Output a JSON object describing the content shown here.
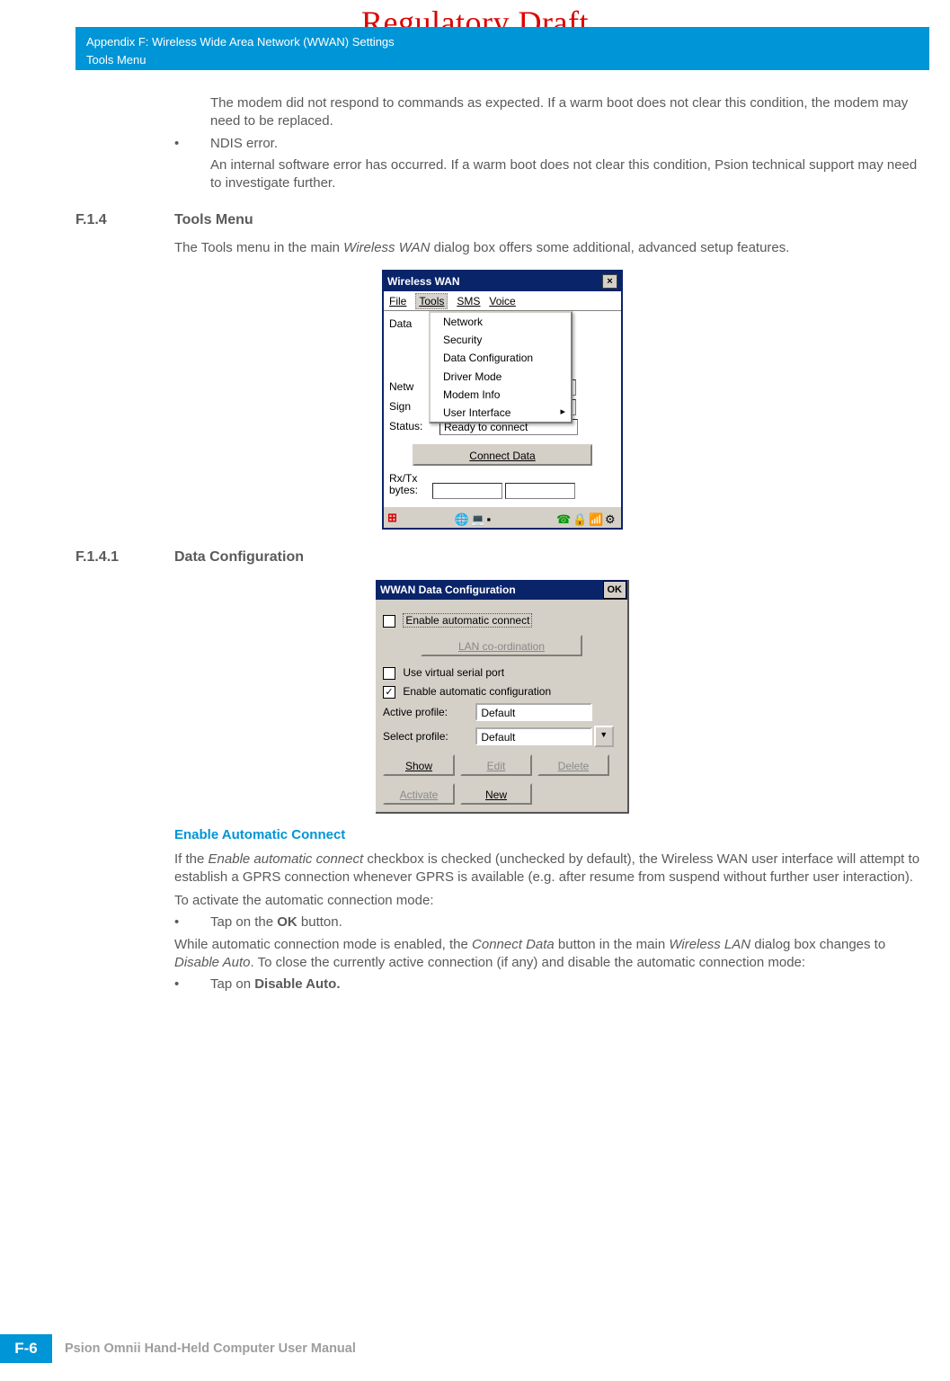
{
  "watermark": "Regulatory Draft",
  "header": {
    "line1": "Appendix F: Wireless Wide Area Network (WWAN) Settings",
    "line2": "Tools Menu"
  },
  "intro": {
    "p1": "The modem did not respond to commands as expected. If a warm boot does not clear this condition, the modem may need to be replaced.",
    "bullet": "NDIS error.",
    "p2": "An internal software error has occurred. If a warm boot does not clear this condition, Psion technical support may need to investigate further."
  },
  "sec_f14": {
    "num": "F.1.4",
    "title": "Tools Menu",
    "desc_pre": "The Tools menu in the main ",
    "desc_em": "Wireless WAN",
    "desc_post": " dialog box offers some additional, advanced setup features."
  },
  "win1": {
    "title": "Wireless WAN",
    "menu": {
      "file": "File",
      "tools": "Tools",
      "sms": "SMS",
      "voice": "Voice"
    },
    "dropdown": [
      "Network",
      "Security",
      "Data Configuration",
      "Driver Mode",
      "Modem Info",
      "User Interface"
    ],
    "labels": {
      "data": "Data",
      "netw": "Netw",
      "sign": "Sign",
      "status": "Status:",
      "rxtx": "Rx/Tx bytes:"
    },
    "status_val": "Ready to connect",
    "connect": "Connect Data"
  },
  "sec_f141": {
    "num": "F.1.4.1",
    "title": "Data Configuration"
  },
  "win2": {
    "title": "WWAN Data Configuration",
    "ok": "OK",
    "chk_auto_connect": "Enable automatic connect",
    "lan_btn": "LAN co-ordination",
    "chk_vserial": "Use virtual serial port",
    "chk_auto_config": "Enable automatic configuration",
    "active_profile_lbl": "Active profile:",
    "select_profile_lbl": "Select profile:",
    "default": "Default",
    "btns": {
      "show": "Show",
      "edit": "Edit",
      "delete": "Delete",
      "activate": "Activate",
      "new": "New"
    }
  },
  "enable_auto": {
    "heading": "Enable Automatic Connect",
    "p1_pre": "If the ",
    "p1_em1": "Enable automatic connect",
    "p1_post": " checkbox is checked (unchecked by default), the Wireless WAN user interface will attempt to establish a GPRS connection whenever GPRS is available (e.g. after resume from suspend without further user interaction).",
    "p2": "To activate the automatic connection mode:",
    "bullet1_pre": "Tap on the ",
    "bullet1_b": "OK",
    "bullet1_post": " button.",
    "p3_pre": "While automatic connection mode is enabled, the ",
    "p3_em1": "Connect Data",
    "p3_mid1": " button in the main ",
    "p3_em2": "Wireless LAN",
    "p3_mid2": " dialog box changes to ",
    "p3_em3": "Disable Auto",
    "p3_post": ". To close the currently active connection (if any) and disable the automatic connection mode:",
    "bullet2_pre": "Tap on ",
    "bullet2_b": "Disable Auto."
  },
  "footer": {
    "page": "F-6",
    "text": "Psion Omnii Hand-Held Computer User Manual"
  }
}
